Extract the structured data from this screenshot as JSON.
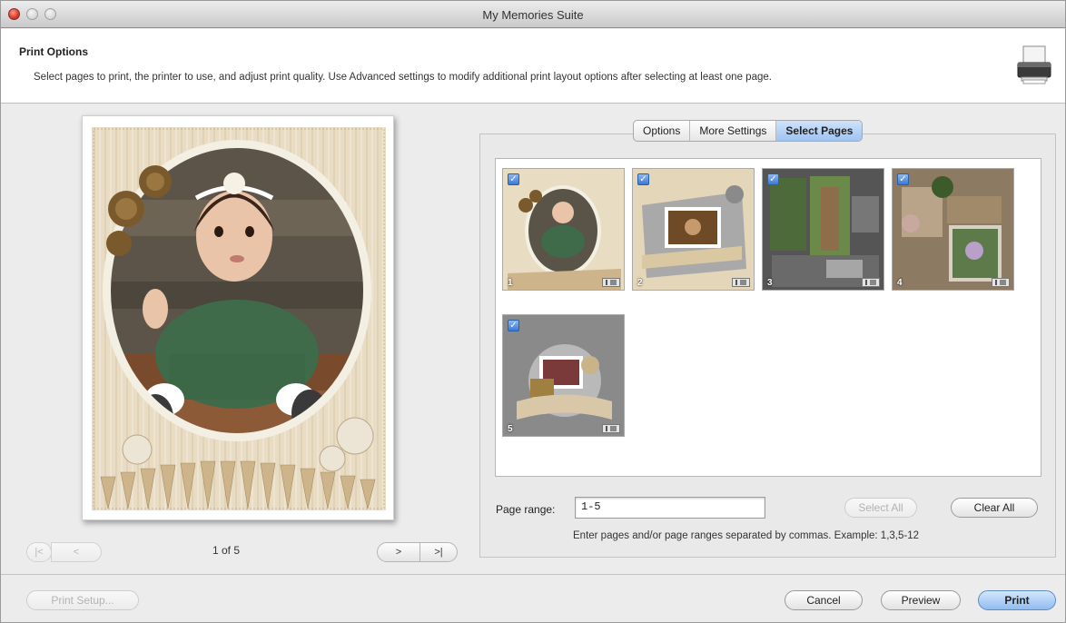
{
  "window": {
    "title": "My Memories Suite"
  },
  "header": {
    "title": "Print Options",
    "description": "Select pages to print, the printer to use, and adjust print quality. Use Advanced settings to modify additional print layout options after selecting at least one page."
  },
  "preview": {
    "first_label": "|<",
    "prev_label": "<",
    "next_label": ">",
    "last_label": ">|",
    "page_counter": "1 of 5"
  },
  "tabs": [
    {
      "label": "Options"
    },
    {
      "label": "More Settings"
    },
    {
      "label": "Select Pages"
    }
  ],
  "thumbnails": [
    {
      "number": "1",
      "checked": true
    },
    {
      "number": "2",
      "checked": true
    },
    {
      "number": "3",
      "checked": true
    },
    {
      "number": "4",
      "checked": true
    },
    {
      "number": "5",
      "checked": true
    }
  ],
  "page_range": {
    "label": "Page range:",
    "value": "1-5",
    "hint": "Enter pages and/or page ranges separated by commas. Example: 1,3,5-12"
  },
  "buttons": {
    "select_all": "Select All",
    "clear_all": "Clear All",
    "print_setup": "Print Setup...",
    "cancel": "Cancel",
    "preview": "Preview",
    "print": "Print"
  },
  "colors": {
    "accent": "#8fbcf0",
    "window_bg": "#ececec",
    "check": "#3a79d6"
  }
}
